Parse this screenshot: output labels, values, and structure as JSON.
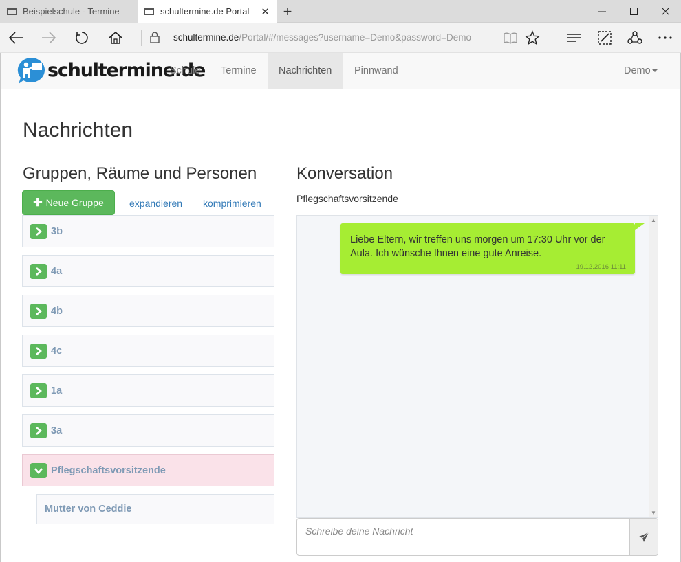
{
  "browser": {
    "tabs": [
      {
        "label": "Beispielschule - Termine",
        "active": false
      },
      {
        "label": "schultermine.de Portal",
        "active": true
      }
    ],
    "url_host": "schultermine.de",
    "url_path": "/Portal/#/messages?username=Demo&password=Demo"
  },
  "site": {
    "logo_text": "schultermine.de",
    "nav": [
      {
        "label": "Schule",
        "active": false
      },
      {
        "label": "Termine",
        "active": false
      },
      {
        "label": "Nachrichten",
        "active": true
      },
      {
        "label": "Pinnwand",
        "active": false
      }
    ],
    "user_menu": "Demo"
  },
  "page": {
    "title": "Nachrichten",
    "groups_heading": "Gruppen, Räume und Personen",
    "new_group_button": "Neue Gruppe",
    "expand_link": "expandieren",
    "collapse_link": "komprimieren",
    "groups": [
      {
        "label": "3b",
        "expanded": false
      },
      {
        "label": "4a",
        "expanded": false
      },
      {
        "label": "4b",
        "expanded": false
      },
      {
        "label": "4c",
        "expanded": false
      },
      {
        "label": "1a",
        "expanded": false
      },
      {
        "label": "3a",
        "expanded": false
      },
      {
        "label": "Pflegschaftsvorsitzende",
        "expanded": true
      }
    ],
    "sub_items": [
      {
        "label": "Mutter von Ceddie"
      }
    ],
    "conversation_heading": "Konversation",
    "conversation_name": "Pflegschaftsvorsitzende",
    "messages": [
      {
        "text": "Liebe Eltern, wir treffen uns morgen um 17:30 Uhr vor der Aula. Ich wünsche Ihnen eine gute Anreise.",
        "time": "19.12.2016 11:11"
      }
    ],
    "message_placeholder": "Schreibe deine Nachricht"
  },
  "colors": {
    "accent_green": "#5cb85c",
    "bubble_green": "#a6ed33",
    "link_blue": "#337ab7",
    "group_text": "#7f9ab5",
    "selected_group_bg": "#fae2e9"
  }
}
